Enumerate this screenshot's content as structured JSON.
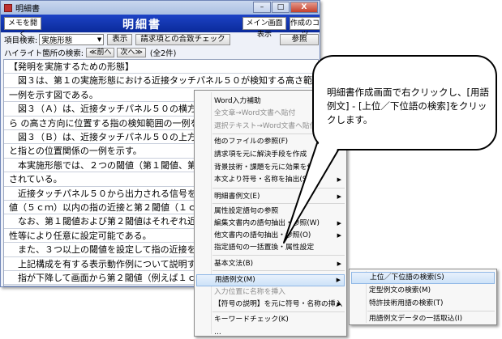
{
  "window": {
    "title": "明細書",
    "minimize": "–",
    "maximize": "□",
    "close": "X"
  },
  "header": {
    "memo_button": "メモを開く",
    "doc_title": "明細書",
    "main_screen_button": "メイン画面表示",
    "tips_button": "作成のコツ"
  },
  "search": {
    "label": "項目検索:",
    "selected": "実施形態",
    "show_button": "表示",
    "claim_check_button": "請求項との合致チェック",
    "reference_button": "参照"
  },
  "highlight": {
    "label": "ハイライト箇所の検索:",
    "prev_button": "≪前へ",
    "next_button": "次へ≫",
    "count": "(全2件)"
  },
  "paragraphs": [
    "【発明を実施するための形態】",
    "　図３は、第１の実施形態における近接タッチパネル５０が検知する高さ範囲の",
    "一例を示す図である。",
    "　図３（Ａ）は、近接タッチパネル５０の横方向",
    "ら の高さ方向に位置する指の検知範囲の一例を示す",
    "　図３（Ｂ）は、近接タッチパネル５０の上方から",
    "と指との位置関係の一例を示す。",
    "　本実施形態では、２つの閾値（第１閾値、第２閾",
    "されている。",
    "　近接タッチパネル５０から出力される信号をもと",
    "値（５ｃｍ）以内の指の近接と第２閾値（１ｃｍ",
    "　なお、第１閾値および第２閾値はそれぞれ近接す",
    "性等により任意に設定可能である。",
    "　また、３つ以上の閾値を設定して指の近接を識別",
    "　上記構成を有する表示動作例について説明する。",
    "　指が下降して画面から第２閾値（例えば１ｃｍ）"
  ],
  "context_menu": [
    {
      "label": "Word入力補助",
      "disabled": false,
      "submenu": false
    },
    {
      "label": "全文章→Word文書へ貼付",
      "disabled": true,
      "submenu": false
    },
    {
      "label": "選択テキスト→Word文書へ貼付",
      "disabled": true,
      "submenu": false
    },
    {
      "label": "他のファイルの参照(F)",
      "disabled": false,
      "submenu": false
    },
    {
      "label": "請求項を元に解決手段を作成",
      "disabled": false,
      "submenu": false
    },
    {
      "label": "背景技術・課題を元に効果を作成",
      "disabled": false,
      "submenu": false
    },
    {
      "label": "本文より符号・名称を抽出(S)",
      "disabled": false,
      "submenu": true
    },
    {
      "label": "明細書例文(E)",
      "disabled": false,
      "submenu": true
    },
    {
      "label": "属性設定語句の参照",
      "disabled": false,
      "submenu": false
    },
    {
      "label": "編集文書内の語句抽出・参照(W)",
      "disabled": false,
      "submenu": true
    },
    {
      "label": "他文書内の語句抽出・参照(O)",
      "disabled": false,
      "submenu": true
    },
    {
      "label": "指定語句の一括置換・属性設定",
      "disabled": false,
      "submenu": false
    },
    {
      "label": "基本文法(B)",
      "disabled": false,
      "submenu": true
    },
    {
      "label": "用語例文(M)",
      "disabled": false,
      "submenu": true,
      "selected": true
    },
    {
      "label": "入力位置に名称を挿入",
      "disabled": true,
      "submenu": false
    },
    {
      "label": "【符号の説明】を元に符号・名称の挿入",
      "disabled": false,
      "submenu": true
    },
    {
      "label": "キーワードチェック(K)",
      "disabled": false,
      "submenu": false
    },
    {
      "label": "…",
      "disabled": false,
      "submenu": false
    }
  ],
  "submenu": [
    {
      "label": "上位／下位語の検索(S)",
      "selected": true
    },
    {
      "label": "定型例文の検索(M)",
      "selected": false
    },
    {
      "label": "特許技術用語の検索(T)",
      "selected": false
    },
    {
      "label": "用語例文データの一括取込(I)",
      "selected": false
    }
  ],
  "callout": {
    "text": "明細書作成画面で右クリックし、[用語例文] - [上位／下位語の検索]をクリックします。"
  }
}
